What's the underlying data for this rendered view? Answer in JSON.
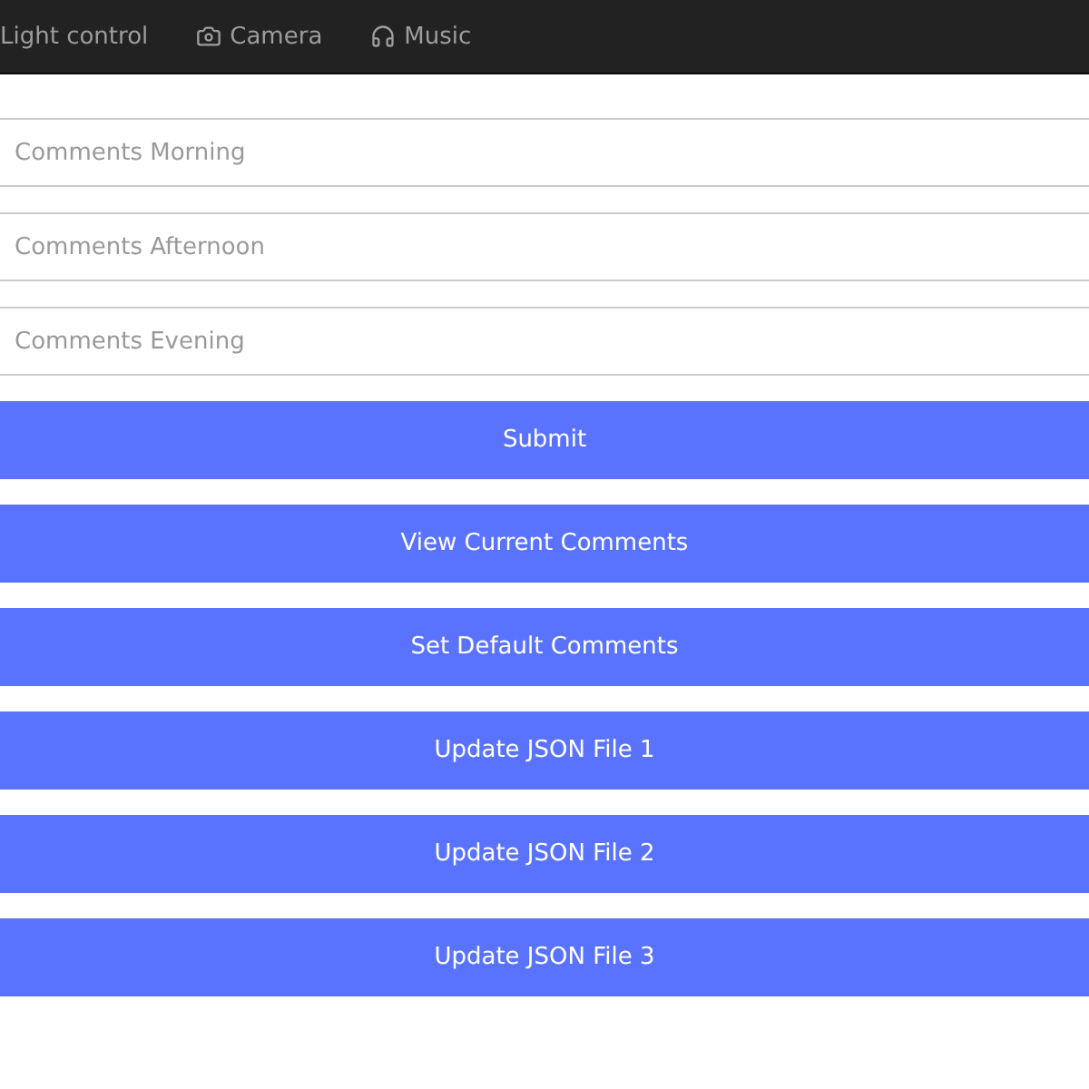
{
  "nav": [
    {
      "label": "Light control"
    },
    {
      "label": "Camera"
    },
    {
      "label": "Music"
    }
  ],
  "fields": [
    {
      "placeholder": "Comments Morning"
    },
    {
      "placeholder": "Comments Afternoon"
    },
    {
      "placeholder": "Comments Evening"
    }
  ],
  "buttons": [
    "Submit",
    "View Current Comments",
    "Set Default Comments",
    "Update JSON File 1",
    "Update JSON File 2",
    "Update JSON File 3"
  ]
}
